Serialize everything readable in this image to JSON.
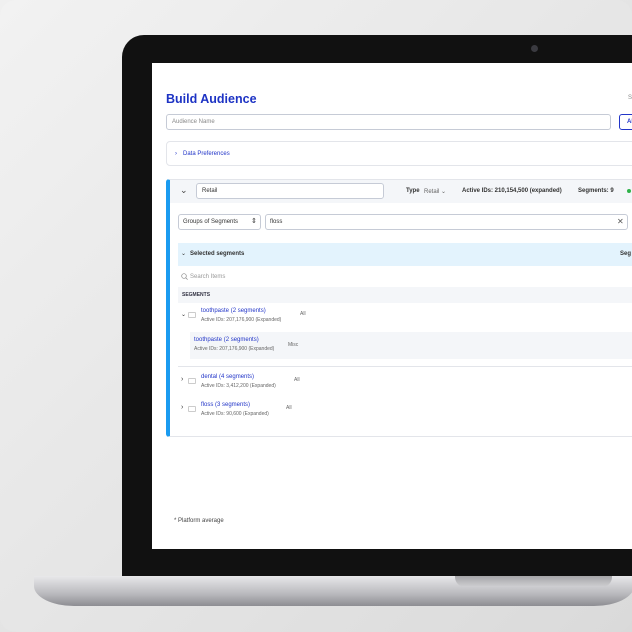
{
  "page": {
    "title": "Build Audience",
    "top_right_truncated": "S",
    "action_button_truncated": "Al"
  },
  "audience_name": {
    "placeholder": "Audience Name",
    "value": ""
  },
  "data_preferences": {
    "label": "Data Preferences"
  },
  "group": {
    "name_value": "Retail",
    "type_label": "Type",
    "type_value": "Retail",
    "active_ids": "Active IDs: 210,154,500 (expanded)",
    "segments_count": "Segments: 9",
    "status_color": "#2fb24a",
    "accent_color": "#1a9bf0",
    "mode_select": "Groups of Segments",
    "search_value": "floss",
    "selected_header": "Selected segments",
    "selected_header_right_truncated": "Seg",
    "search_items_placeholder": "Search Items",
    "segments_heading": "SEGMENTS",
    "items": [
      {
        "name": "toothpaste (2 segments)",
        "ids": "Active IDs: 207,176,900 (Expanded)",
        "tag": "All",
        "expanded": true,
        "children": [
          {
            "name": "toothpaste (2 segments)",
            "ids": "Active IDs: 207,176,900 (Expanded)",
            "tag": "Misc"
          }
        ]
      },
      {
        "name": "dental (4 segments)",
        "ids": "Active IDs: 3,412,200 (Expanded)",
        "tag": "All",
        "expanded": false
      },
      {
        "name": "floss (3 segments)",
        "ids": "Active IDs: 90,600 (Expanded)",
        "tag": "All",
        "expanded": false
      }
    ]
  },
  "footnote": "* Platform average"
}
